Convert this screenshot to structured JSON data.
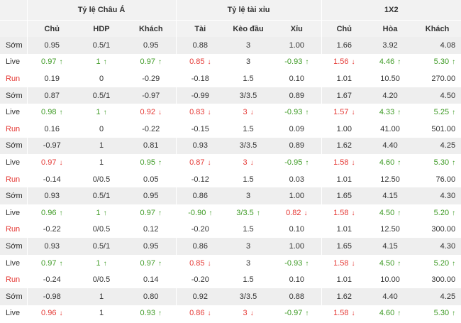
{
  "groups": [
    "Tỷ lệ Châu Á",
    "Tỷ lệ tài xỉu",
    "1X2"
  ],
  "columns": [
    "Chủ",
    "HDP",
    "Khách",
    "Tài",
    "Kèo đầu",
    "Xỉu",
    "Chủ",
    "Hòa",
    "Khách"
  ],
  "rows": [
    {
      "label": "Sớm",
      "type": "som",
      "cells": [
        {
          "v": "0.95"
        },
        {
          "v": "0.5/1"
        },
        {
          "v": "0.95"
        },
        {
          "v": "0.88"
        },
        {
          "v": "3"
        },
        {
          "v": "1.00"
        },
        {
          "v": "1.66"
        },
        {
          "v": "3.92"
        },
        {
          "v": "4.08"
        }
      ]
    },
    {
      "label": "Live",
      "type": "live",
      "cells": [
        {
          "v": "0.97",
          "d": "up"
        },
        {
          "v": "1",
          "d": "up"
        },
        {
          "v": "0.97",
          "d": "up"
        },
        {
          "v": "0.85",
          "d": "down"
        },
        {
          "v": "3"
        },
        {
          "v": "-0.93",
          "d": "up"
        },
        {
          "v": "1.56",
          "d": "down"
        },
        {
          "v": "4.46",
          "d": "up"
        },
        {
          "v": "5.30",
          "d": "up"
        }
      ]
    },
    {
      "label": "Run",
      "type": "run",
      "cells": [
        {
          "v": "0.19"
        },
        {
          "v": "0"
        },
        {
          "v": "-0.29"
        },
        {
          "v": "-0.18"
        },
        {
          "v": "1.5"
        },
        {
          "v": "0.10"
        },
        {
          "v": "1.01"
        },
        {
          "v": "10.50"
        },
        {
          "v": "270.00"
        }
      ]
    },
    {
      "label": "Sớm",
      "type": "som",
      "cells": [
        {
          "v": "0.87"
        },
        {
          "v": "0.5/1"
        },
        {
          "v": "-0.97"
        },
        {
          "v": "-0.99"
        },
        {
          "v": "3/3.5"
        },
        {
          "v": "0.89"
        },
        {
          "v": "1.67"
        },
        {
          "v": "4.20"
        },
        {
          "v": "4.50"
        }
      ]
    },
    {
      "label": "Live",
      "type": "live",
      "cells": [
        {
          "v": "0.98",
          "d": "up"
        },
        {
          "v": "1",
          "d": "up"
        },
        {
          "v": "0.92",
          "d": "down"
        },
        {
          "v": "0.83",
          "d": "down"
        },
        {
          "v": "3",
          "d": "down"
        },
        {
          "v": "-0.93",
          "d": "up"
        },
        {
          "v": "1.57",
          "d": "down"
        },
        {
          "v": "4.33",
          "d": "up"
        },
        {
          "v": "5.25",
          "d": "up"
        }
      ]
    },
    {
      "label": "Run",
      "type": "run",
      "cells": [
        {
          "v": "0.16"
        },
        {
          "v": "0"
        },
        {
          "v": "-0.22"
        },
        {
          "v": "-0.15"
        },
        {
          "v": "1.5"
        },
        {
          "v": "0.09"
        },
        {
          "v": "1.00"
        },
        {
          "v": "41.00"
        },
        {
          "v": "501.00"
        }
      ]
    },
    {
      "label": "Sớm",
      "type": "som",
      "cells": [
        {
          "v": "-0.97"
        },
        {
          "v": "1"
        },
        {
          "v": "0.81"
        },
        {
          "v": "0.93"
        },
        {
          "v": "3/3.5"
        },
        {
          "v": "0.89"
        },
        {
          "v": "1.62"
        },
        {
          "v": "4.40"
        },
        {
          "v": "4.25"
        }
      ]
    },
    {
      "label": "Live",
      "type": "live",
      "cells": [
        {
          "v": "0.97",
          "d": "down"
        },
        {
          "v": "1"
        },
        {
          "v": "0.95",
          "d": "up"
        },
        {
          "v": "0.87",
          "d": "down"
        },
        {
          "v": "3",
          "d": "down"
        },
        {
          "v": "-0.95",
          "d": "up"
        },
        {
          "v": "1.58",
          "d": "down"
        },
        {
          "v": "4.60",
          "d": "up"
        },
        {
          "v": "5.30",
          "d": "up"
        }
      ]
    },
    {
      "label": "Run",
      "type": "run",
      "cells": [
        {
          "v": "-0.14"
        },
        {
          "v": "0/0.5"
        },
        {
          "v": "0.05"
        },
        {
          "v": "-0.12"
        },
        {
          "v": "1.5"
        },
        {
          "v": "0.03"
        },
        {
          "v": "1.01"
        },
        {
          "v": "12.50"
        },
        {
          "v": "76.00"
        }
      ]
    },
    {
      "label": "Sớm",
      "type": "som",
      "cells": [
        {
          "v": "0.93"
        },
        {
          "v": "0.5/1"
        },
        {
          "v": "0.95"
        },
        {
          "v": "0.86"
        },
        {
          "v": "3"
        },
        {
          "v": "1.00"
        },
        {
          "v": "1.65"
        },
        {
          "v": "4.15"
        },
        {
          "v": "4.30"
        }
      ]
    },
    {
      "label": "Live",
      "type": "live",
      "cells": [
        {
          "v": "0.96",
          "d": "up"
        },
        {
          "v": "1",
          "d": "up"
        },
        {
          "v": "0.97",
          "d": "up"
        },
        {
          "v": "-0.90",
          "d": "up"
        },
        {
          "v": "3/3.5",
          "d": "up"
        },
        {
          "v": "0.82",
          "d": "down"
        },
        {
          "v": "1.58",
          "d": "down"
        },
        {
          "v": "4.50",
          "d": "up"
        },
        {
          "v": "5.20",
          "d": "up"
        }
      ]
    },
    {
      "label": "Run",
      "type": "run",
      "cells": [
        {
          "v": "-0.22"
        },
        {
          "v": "0/0.5"
        },
        {
          "v": "0.12"
        },
        {
          "v": "-0.20"
        },
        {
          "v": "1.5"
        },
        {
          "v": "0.10"
        },
        {
          "v": "1.01"
        },
        {
          "v": "12.50"
        },
        {
          "v": "300.00"
        }
      ]
    },
    {
      "label": "Sớm",
      "type": "som",
      "cells": [
        {
          "v": "0.93"
        },
        {
          "v": "0.5/1"
        },
        {
          "v": "0.95"
        },
        {
          "v": "0.86"
        },
        {
          "v": "3"
        },
        {
          "v": "1.00"
        },
        {
          "v": "1.65"
        },
        {
          "v": "4.15"
        },
        {
          "v": "4.30"
        }
      ]
    },
    {
      "label": "Live",
      "type": "live",
      "cells": [
        {
          "v": "0.97",
          "d": "up"
        },
        {
          "v": "1",
          "d": "up"
        },
        {
          "v": "0.97",
          "d": "up"
        },
        {
          "v": "0.85",
          "d": "down"
        },
        {
          "v": "3"
        },
        {
          "v": "-0.93",
          "d": "up"
        },
        {
          "v": "1.58",
          "d": "down"
        },
        {
          "v": "4.50",
          "d": "up"
        },
        {
          "v": "5.20",
          "d": "up"
        }
      ]
    },
    {
      "label": "Run",
      "type": "run",
      "cells": [
        {
          "v": "-0.24"
        },
        {
          "v": "0/0.5"
        },
        {
          "v": "0.14"
        },
        {
          "v": "-0.20"
        },
        {
          "v": "1.5"
        },
        {
          "v": "0.10"
        },
        {
          "v": "1.01"
        },
        {
          "v": "10.00"
        },
        {
          "v": "300.00"
        }
      ]
    },
    {
      "label": "Sớm",
      "type": "som",
      "cells": [
        {
          "v": "-0.98"
        },
        {
          "v": "1"
        },
        {
          "v": "0.80"
        },
        {
          "v": "0.92"
        },
        {
          "v": "3/3.5"
        },
        {
          "v": "0.88"
        },
        {
          "v": "1.62"
        },
        {
          "v": "4.40"
        },
        {
          "v": "4.25"
        }
      ]
    },
    {
      "label": "Live",
      "type": "live",
      "cells": [
        {
          "v": "0.96",
          "d": "down"
        },
        {
          "v": "1"
        },
        {
          "v": "0.93",
          "d": "up"
        },
        {
          "v": "0.86",
          "d": "down"
        },
        {
          "v": "3",
          "d": "down"
        },
        {
          "v": "-0.97",
          "d": "up"
        },
        {
          "v": "1.58",
          "d": "down"
        },
        {
          "v": "4.60",
          "d": "up"
        },
        {
          "v": "5.30",
          "d": "up"
        }
      ]
    }
  ],
  "colors": {
    "up": "#3f9b26",
    "down": "#e53935",
    "shade": "#eeeeee",
    "header": "#f2f2f2"
  }
}
